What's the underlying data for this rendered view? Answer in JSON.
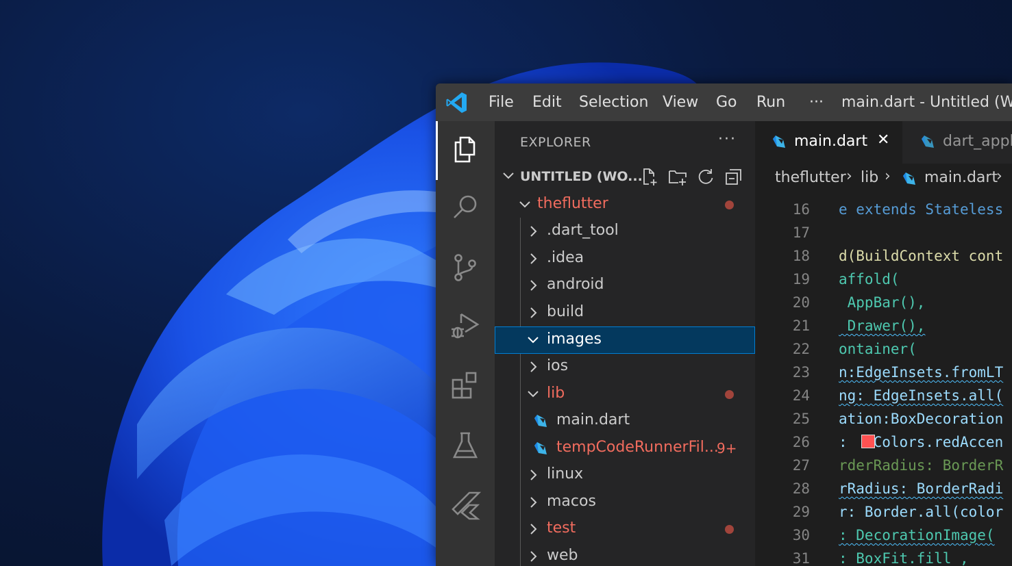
{
  "window": {
    "title": "main.dart - Untitled (Work",
    "menu": [
      "File",
      "Edit",
      "Selection",
      "View",
      "Go",
      "Run",
      "···"
    ]
  },
  "activity_bar": {
    "icons": [
      "explorer-icon",
      "search-icon",
      "source-control-icon",
      "run-debug-icon",
      "extensions-icon",
      "testing-icon",
      "flutter-icon"
    ]
  },
  "explorer": {
    "title": "EXPLORER",
    "more": "···",
    "workspace_title": "UNTITLED (WO...",
    "tree": [
      {
        "label": "theflutter",
        "kind": "folder-open",
        "modified": true,
        "badge": ""
      },
      {
        "label": ".dart_tool",
        "kind": "folder",
        "modified": false,
        "badge": ""
      },
      {
        "label": ".idea",
        "kind": "folder",
        "modified": false,
        "badge": ""
      },
      {
        "label": "android",
        "kind": "folder",
        "modified": false,
        "badge": ""
      },
      {
        "label": "build",
        "kind": "folder",
        "modified": false,
        "badge": ""
      },
      {
        "label": "images",
        "kind": "folder-open",
        "modified": false,
        "badge": "",
        "selected": true
      },
      {
        "label": "ios",
        "kind": "folder",
        "modified": false,
        "badge": ""
      },
      {
        "label": "lib",
        "kind": "folder-open",
        "modified": true,
        "badge": ""
      },
      {
        "label": "main.dart",
        "kind": "dart-file",
        "modified": false,
        "badge": ""
      },
      {
        "label": "tempCodeRunnerFil...",
        "kind": "dart-file",
        "modified": true,
        "badge": "9+"
      },
      {
        "label": "linux",
        "kind": "folder",
        "modified": false,
        "badge": ""
      },
      {
        "label": "macos",
        "kind": "folder",
        "modified": false,
        "badge": ""
      },
      {
        "label": "test",
        "kind": "folder",
        "modified": true,
        "badge": ""
      },
      {
        "label": "web",
        "kind": "folder",
        "modified": false,
        "badge": ""
      }
    ]
  },
  "editor": {
    "tabs": [
      {
        "label": "main.dart",
        "active": true,
        "close": "✕"
      },
      {
        "label": "dart_appli",
        "active": false,
        "close": ""
      }
    ],
    "breadcrumb": {
      "items": [
        "theflutter",
        "lib",
        "main.dart"
      ],
      "separator": "›"
    },
    "lines": [
      {
        "n": "16",
        "text": "e extends Stateless"
      },
      {
        "n": "17",
        "text": ""
      },
      {
        "n": "18",
        "text": "d(BuildContext cont"
      },
      {
        "n": "19",
        "text": "affold("
      },
      {
        "n": "20",
        "text": " AppBar(),"
      },
      {
        "n": "21",
        "text": " Drawer(),"
      },
      {
        "n": "22",
        "text": "ontainer("
      },
      {
        "n": "23",
        "text": "n:EdgeInsets.fromLT"
      },
      {
        "n": "24",
        "text": "ng: EdgeInsets.all("
      },
      {
        "n": "25",
        "text": "ation:BoxDecoration"
      },
      {
        "n": "26",
        "text": ":   Colors.redAccen"
      },
      {
        "n": "27",
        "text": "rderRadius: BorderR"
      },
      {
        "n": "28",
        "text": "rRadius: BorderRadi"
      },
      {
        "n": "29",
        "text": "r: Border.all(color"
      },
      {
        "n": "30",
        "text": ": DecorationImage("
      },
      {
        "n": "31",
        "text": ": BoxFit.fill ,"
      }
    ]
  },
  "colors": {
    "accent": "#007fd4",
    "modified": "#f16c5e",
    "selection": "#04395e",
    "swatch_red": "#ff5252"
  }
}
